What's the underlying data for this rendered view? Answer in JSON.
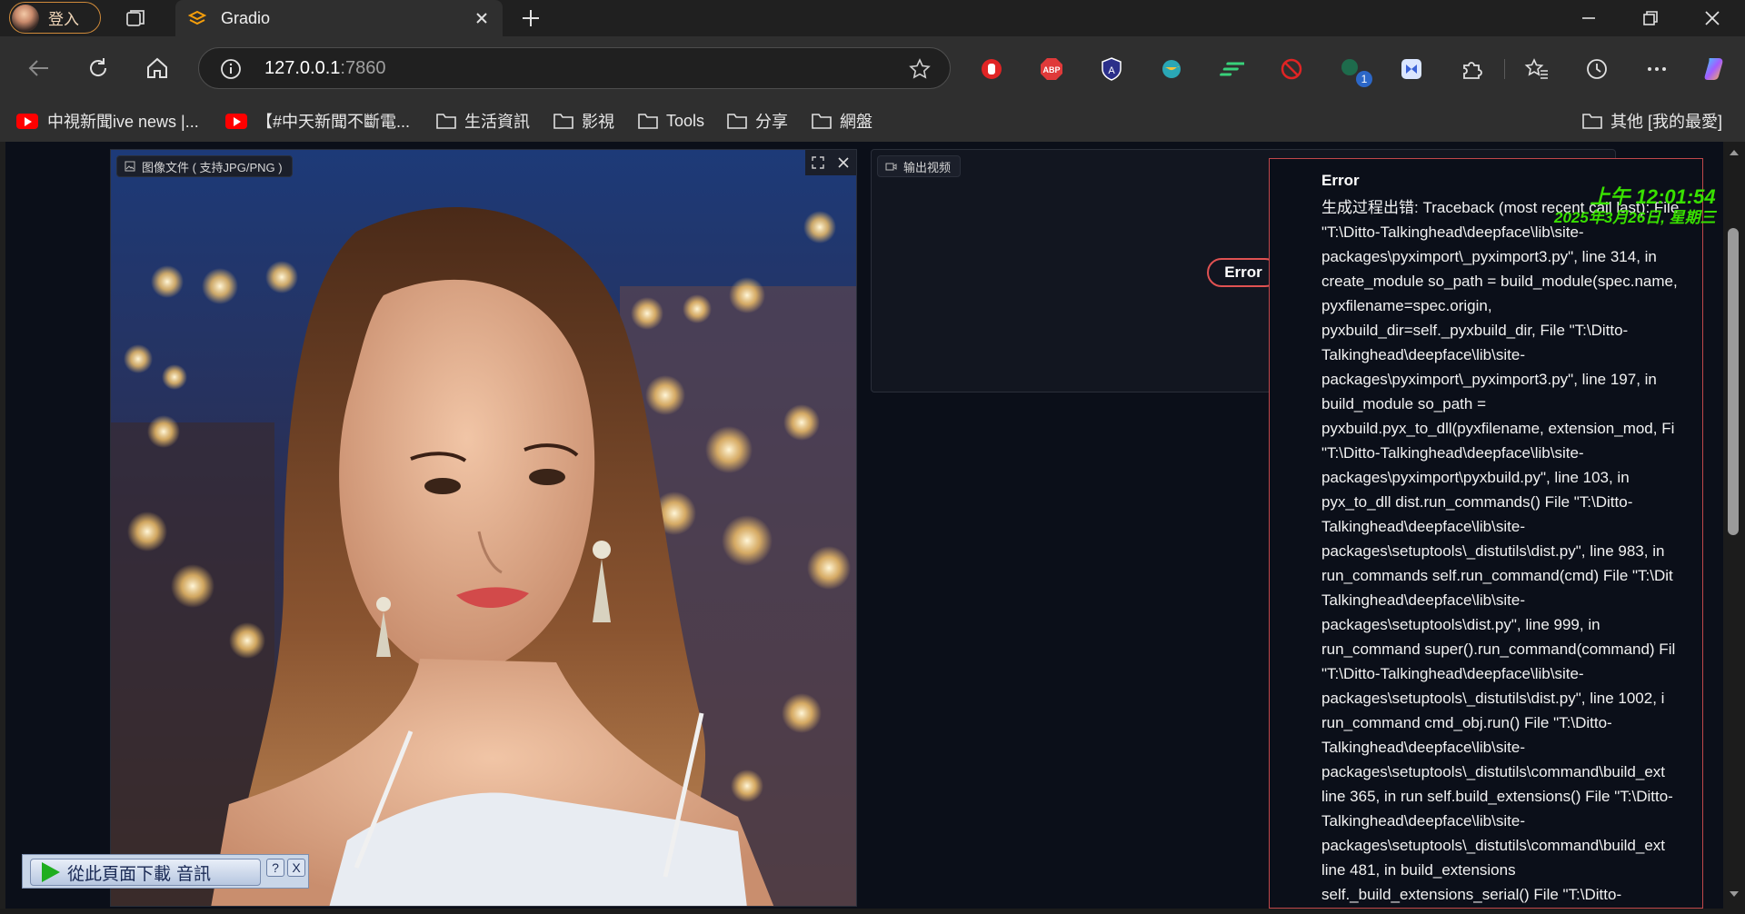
{
  "browser": {
    "profile_label": "登入",
    "tab_title": "Gradio",
    "url_host": "127.0.0.1",
    "url_port": ":7860"
  },
  "bookmarks": [
    {
      "label": "中視新聞ive news |...",
      "icon": "youtube-icon"
    },
    {
      "label": "【#中天新聞不斷電...",
      "icon": "youtube-icon"
    },
    {
      "label": "生活資訊",
      "icon": "folder-icon"
    },
    {
      "label": "影視",
      "icon": "folder-icon"
    },
    {
      "label": "Tools",
      "icon": "folder-icon"
    },
    {
      "label": "分享",
      "icon": "folder-icon"
    },
    {
      "label": "網盤",
      "icon": "folder-icon"
    },
    {
      "label": "其他 [我的最愛]",
      "icon": "folder-icon"
    }
  ],
  "extensions": [
    "stop-hand-icon",
    "adblock-plus-icon",
    "shield-a-icon",
    "globe-icon",
    "speed-icon",
    "block-icon",
    "notify-icon",
    "app-icon",
    "puzzle-icon",
    "favorites-icon",
    "history-icon",
    "more-icon",
    "copilot-icon"
  ],
  "extension_badge": "1",
  "gradio": {
    "image_label": "图像文件 ( 支持JPG/PNG )",
    "output_label": "输出视频",
    "error_pill": "Error",
    "error_title": "Error",
    "error_lines": [
      "生成过程出错: Traceback (most recent call last): File",
      "\"T:\\Ditto-Talkinghead\\deepface\\lib\\site-",
      "packages\\pyximport\\_pyximport3.py\", line 314, in",
      "create_module so_path = build_module(spec.name,",
      "pyxfilename=spec.origin,",
      "pyxbuild_dir=self._pyxbuild_dir, File \"T:\\Ditto-",
      "Talkinghead\\deepface\\lib\\site-",
      "packages\\pyximport\\_pyximport3.py\", line 197, in",
      "build_module so_path =",
      "pyxbuild.pyx_to_dll(pyxfilename, extension_mod, Fi",
      "\"T:\\Ditto-Talkinghead\\deepface\\lib\\site-",
      "packages\\pyximport\\pyxbuild.py\", line 103, in",
      "pyx_to_dll dist.run_commands() File \"T:\\Ditto-",
      "Talkinghead\\deepface\\lib\\site-",
      "packages\\setuptools\\_distutils\\dist.py\", line 983, in",
      "run_commands self.run_command(cmd) File \"T:\\Dit",
      "Talkinghead\\deepface\\lib\\site-",
      "packages\\setuptools\\dist.py\", line 999, in",
      "run_command super().run_command(command) Fil",
      "\"T:\\Ditto-Talkinghead\\deepface\\lib\\site-",
      "packages\\setuptools\\_distutils\\dist.py\", line 1002, i",
      "run_command cmd_obj.run() File \"T:\\Ditto-",
      "Talkinghead\\deepface\\lib\\site-",
      "packages\\setuptools\\_distutils\\command\\build_ext",
      "line 365, in run self.build_extensions() File \"T:\\Ditto-",
      "Talkinghead\\deepface\\lib\\site-",
      "packages\\setuptools\\_distutils\\command\\build_ext",
      "line 481, in build_extensions",
      "self._build_extensions_serial() File \"T:\\Ditto-"
    ]
  },
  "clock": {
    "time": "上午 12:01:54",
    "date": "2025年3月26日, 星期三"
  },
  "download_widget": {
    "label": "從此頁面下載 音訊",
    "help": "?",
    "close": "X"
  },
  "colors": {
    "error_border": "#e05252",
    "clock_green": "#39e000",
    "background": "#0b0f19"
  }
}
